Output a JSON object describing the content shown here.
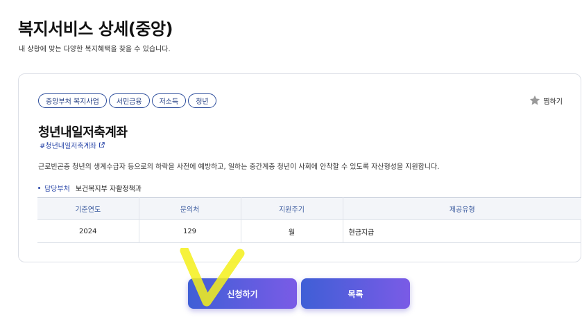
{
  "header": {
    "title": "복지서비스 상세(중앙)",
    "subtitle": "내 상황에 맞는 다양한 복지혜택을 찾을 수 있습니다."
  },
  "service": {
    "tags": [
      "중앙부처 복지사업",
      "서민금융",
      "저소득",
      "청년"
    ],
    "favorite_label": "찜하기",
    "title": "청년내일저축계좌",
    "hashtag": "#청년내일저축계좌",
    "description": "근로빈곤층 청년의 생계수급자 등으로의 하락을 사전에 예방하고, 일하는 중간계층 청년이 사회에 안착할 수 있도록 자산형성을 지원합니다.",
    "dept_label": "담당부처",
    "dept_value": "보건복지부 자활정책과"
  },
  "table": {
    "headers": [
      "기준연도",
      "문의처",
      "지원주기",
      "제공유형"
    ],
    "row": [
      "2024",
      "129",
      "월",
      "현금지급"
    ]
  },
  "buttons": {
    "apply": "신청하기",
    "list": "목록"
  },
  "colors": {
    "accent": "#2a47a8",
    "button_start": "#3f5fd6",
    "button_end": "#7a5be6",
    "annotation": "#f5f01a"
  }
}
